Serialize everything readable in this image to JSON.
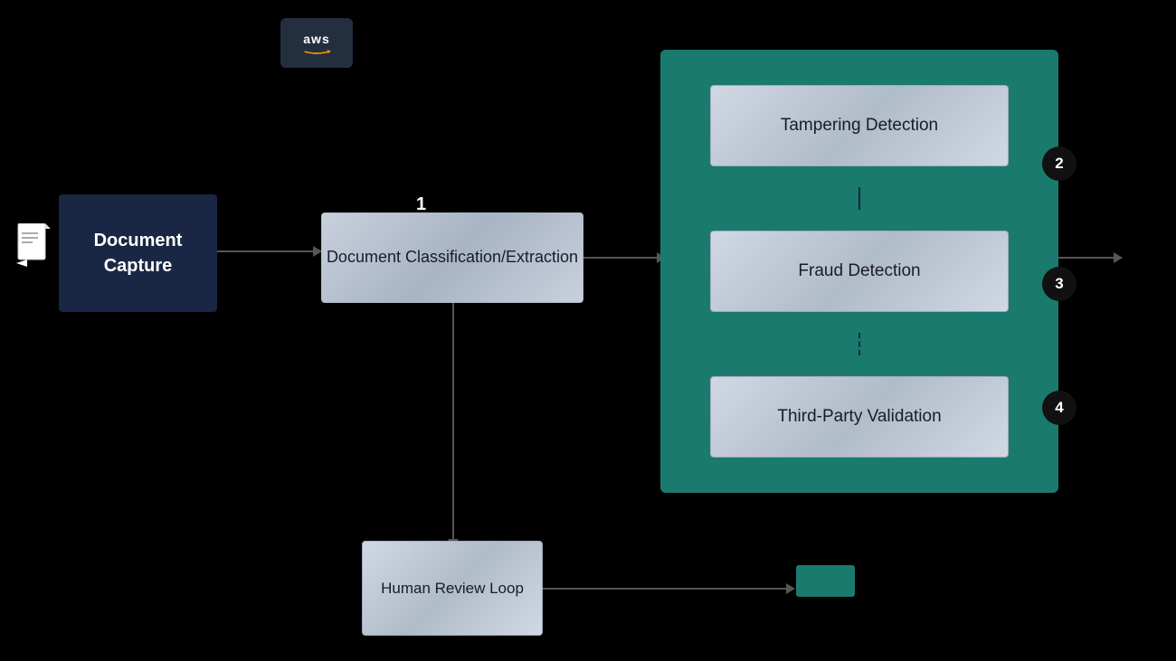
{
  "background": "#000000",
  "aws": {
    "logo_text": "aws",
    "logo_bg": "#232f3e"
  },
  "steps": {
    "step1_label": "1",
    "step2_label": "2",
    "step3_label": "3",
    "step4_label": "4"
  },
  "doc_capture": {
    "label": "Document\nCapture"
  },
  "doc_classification": {
    "label": "Document\nClassification/Extraction"
  },
  "tampering": {
    "label": "Tampering Detection"
  },
  "fraud": {
    "label": "Fraud Detection"
  },
  "third_party": {
    "label": "Third-Party Validation"
  },
  "human_review": {
    "label": "Human\nReview Loop"
  },
  "colors": {
    "teal_panel": "#1a7a6e",
    "doc_capture_bg": "#1a2744",
    "box_gradient_start": "#d0d8e4",
    "box_gradient_end": "#b0bcc8",
    "black_badge": "#111111",
    "arrow_color": "#555555"
  }
}
